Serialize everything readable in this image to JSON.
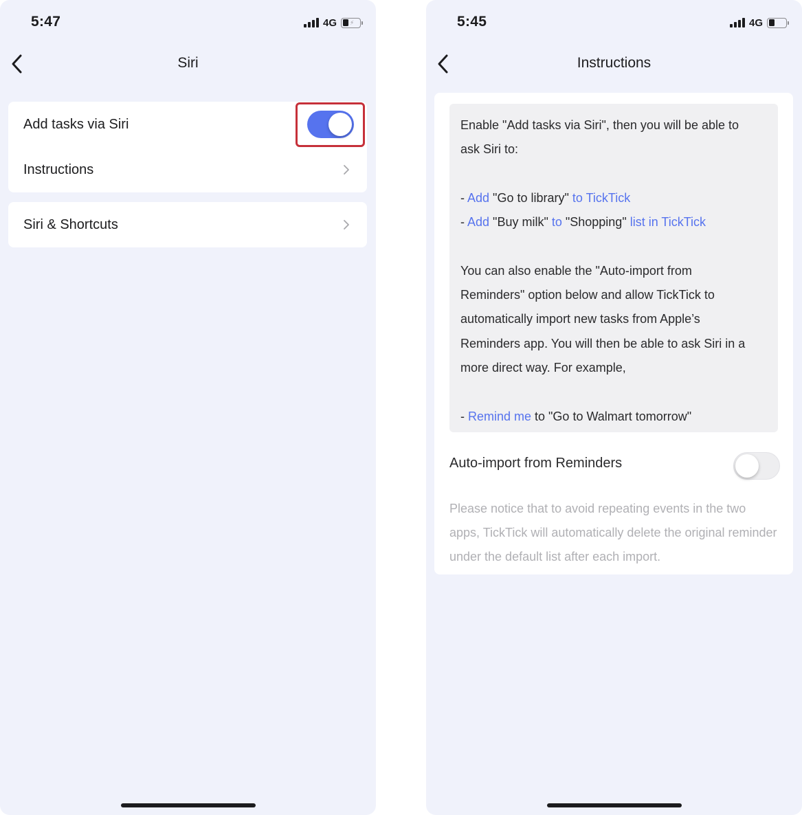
{
  "left": {
    "status": {
      "time": "5:47",
      "network": "4G"
    },
    "nav": {
      "title": "Siri"
    },
    "rows": {
      "add_tasks": {
        "label": "Add tasks via Siri",
        "toggle": "on"
      },
      "instructions": {
        "label": "Instructions"
      },
      "shortcuts": {
        "label": "Siri & Shortcuts"
      }
    }
  },
  "right": {
    "status": {
      "time": "5:45",
      "network": "4G"
    },
    "nav": {
      "title": "Instructions"
    },
    "instructions": {
      "intro_1": "Enable \"Add tasks via Siri\", then you will be able to",
      "intro_2": "ask Siri to:",
      "ex1": {
        "dash": "- ",
        "add": "Add",
        "item": " \"Go to library\" ",
        "target": "to TickTick"
      },
      "ex2": {
        "dash": "- ",
        "add": "Add",
        "item": " \"Buy milk\" ",
        "to": "to",
        "list": " \"Shopping\" ",
        "target": "list in TickTick"
      },
      "para_1": "You can also enable the \"Auto-import from",
      "para_2": "Reminders\" option below and allow TickTick to",
      "para_3": "automatically import new tasks from Apple’s",
      "para_4": "Reminders app. You will then be able to ask Siri in a",
      "para_5": "more direct way. For example,",
      "ex3": {
        "dash": "- ",
        "remind": "Remind me",
        "rest": " to \"Go to Walmart tomorrow\""
      }
    },
    "auto_import": {
      "label": "Auto-import from Reminders",
      "toggle": "off"
    },
    "notice": "Please notice that to avoid repeating events in the two apps, TickTick will automatically delete the original reminder under the default list after each import."
  },
  "colors": {
    "accent": "#5673ee",
    "highlight": "#c6303a",
    "background": "#f0f2fb"
  }
}
